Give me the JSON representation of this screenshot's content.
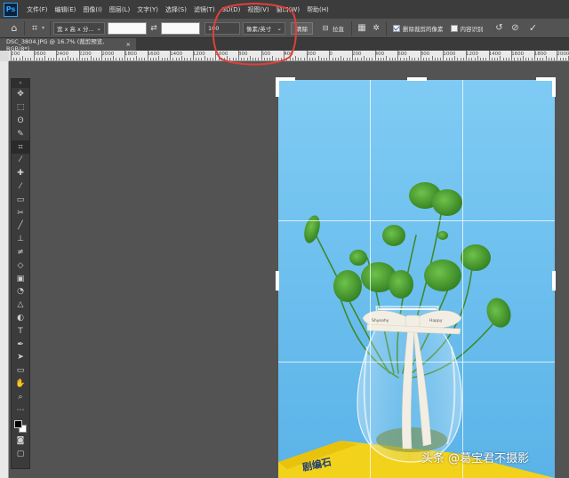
{
  "app": {
    "logo": "Ps"
  },
  "menu": [
    "文件(F)",
    "编辑(E)",
    "图像(I)",
    "图层(L)",
    "文字(Y)",
    "选择(S)",
    "滤镜(T)",
    "3D(D)",
    "视图(V)",
    "窗口(W)",
    "帮助(H)"
  ],
  "options": {
    "ratio_select": "宽 x 高 x 分...",
    "width_value": "",
    "height_value": "",
    "resolution_value": "100",
    "unit_select": "像素/英寸",
    "clear_button": "清除",
    "straighten_label": "拉直",
    "delete_cropped_label": "删除裁剪的像素",
    "delete_cropped_checked": true,
    "content_aware_label": "内容识别",
    "content_aware_checked": false
  },
  "document_tab": {
    "title": "DSC_3804.JPG @ 16.7% (裁剪预览, RGB/8*)"
  },
  "ruler": {
    "labels": [
      "200",
      "2600",
      "2400",
      "2200",
      "2000",
      "1800",
      "1600",
      "1400",
      "1200",
      "1000",
      "800",
      "600",
      "400",
      "200",
      "0",
      "200",
      "400",
      "600",
      "800",
      "1000",
      "1200",
      "1400",
      "1600",
      "1800",
      "2000"
    ]
  },
  "photo": {
    "bag_text": "Happy",
    "ribbon_text": "Shyeahy",
    "book_text": "剧编石"
  },
  "watermark": "头条 @葛宝君不摄影",
  "colors": {
    "sky": "#7cc8f2",
    "menubar": "#3c3c3c",
    "panel": "#535353",
    "annotation": "#e0403a"
  }
}
